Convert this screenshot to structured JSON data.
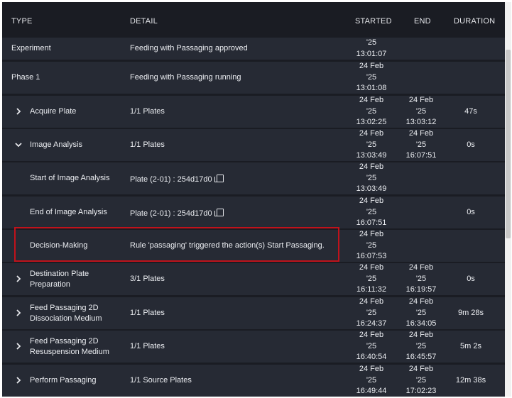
{
  "columns": {
    "type": "TYPE",
    "detail": "DETAIL",
    "started": "STARTED",
    "end": "END",
    "duration": "DURATION"
  },
  "rows": [
    {
      "type": "Experiment",
      "detail": "Feeding with Passaging approved",
      "started": [
        "'25",
        "13:01:07"
      ],
      "end": [],
      "duration": "",
      "chevron": ""
    },
    {
      "type": "Phase 1",
      "detail": "Feeding with Passaging running",
      "started": [
        "24 Feb",
        "'25",
        "13:01:08"
      ],
      "end": [],
      "duration": "",
      "chevron": ""
    },
    {
      "type": "Acquire Plate",
      "detail": "1/1 Plates",
      "started": [
        "24 Feb",
        "'25",
        "13:02:25"
      ],
      "end": [
        "24 Feb",
        "'25",
        "13:03:12"
      ],
      "duration": "47s",
      "chevron": "right"
    },
    {
      "type": "Image Analysis",
      "detail": "1/1 Plates",
      "started": [
        "24 Feb",
        "'25",
        "13:03:49"
      ],
      "end": [
        "24 Feb",
        "'25",
        "16:07:51"
      ],
      "duration": "0s",
      "chevron": "down"
    },
    {
      "type": "Start of Image Analysis",
      "detail": "Plate (2-01) : 254d17d0",
      "started": [
        "24 Feb",
        "'25",
        "13:03:49"
      ],
      "end": [],
      "duration": "",
      "chevron": "",
      "copy": true
    },
    {
      "type": "End of Image Analysis",
      "detail": "Plate (2-01) : 254d17d0",
      "started": [
        "24 Feb",
        "'25",
        "16:07:51"
      ],
      "end": [],
      "duration": "0s",
      "chevron": "",
      "copy": true
    },
    {
      "type": "Decision-Making",
      "detail": "Rule 'passaging' triggered the action(s) Start Passaging.",
      "started": [
        "24 Feb",
        "'25",
        "16:07:53"
      ],
      "end": [],
      "duration": "",
      "chevron": ""
    },
    {
      "type": [
        "Destination Plate",
        "Preparation"
      ],
      "detail": "3/1 Plates",
      "started": [
        "24 Feb",
        "'25",
        "16:11:32"
      ],
      "end": [
        "24 Feb",
        "'25",
        "16:19:57"
      ],
      "duration": "0s",
      "chevron": "right"
    },
    {
      "type": [
        "Feed Passaging 2D",
        "Dissociation Medium"
      ],
      "detail": "1/1 Plates",
      "started": [
        "24 Feb",
        "'25",
        "16:24:37"
      ],
      "end": [
        "24 Feb",
        "'25",
        "16:34:05"
      ],
      "duration": "9m 28s",
      "chevron": "right"
    },
    {
      "type": [
        "Feed Passaging 2D",
        "Resuspension Medium"
      ],
      "detail": "1/1 Plates",
      "started": [
        "24 Feb",
        "'25",
        "16:40:54"
      ],
      "end": [
        "24 Feb",
        "'25",
        "16:45:57"
      ],
      "duration": "5m 2s",
      "chevron": "right"
    },
    {
      "type": "Perform Passaging",
      "detail": "1/1 Source Plates",
      "started": [
        "24 Feb",
        "'25",
        "16:49:44"
      ],
      "end": [
        "24 Feb",
        "'25",
        "17:02:23"
      ],
      "duration": "12m 38s",
      "chevron": "right"
    }
  ],
  "colors": {
    "background": "#1a1c23",
    "row": "#262a34",
    "highlight": "#c0121b"
  }
}
